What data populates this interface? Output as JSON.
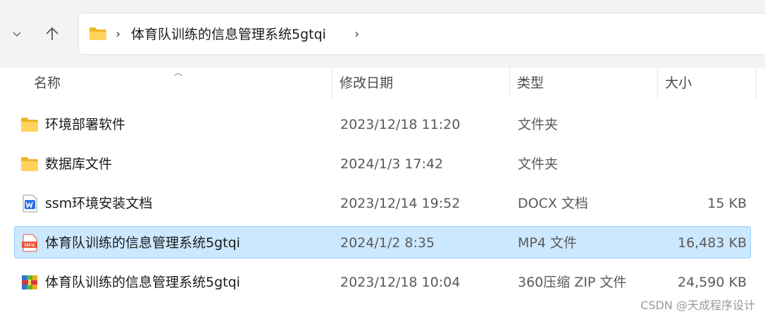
{
  "address": {
    "crumb": "体育队训练的信息管理系统5gtqi"
  },
  "columns": {
    "name": "名称",
    "date": "修改日期",
    "type": "类型",
    "size": "大小"
  },
  "files": [
    {
      "name": "环境部署软件",
      "date": "2023/12/18 11:20",
      "type": "文件夹",
      "size": "",
      "icon": "folder-icon",
      "selected": false
    },
    {
      "name": "数据库文件",
      "date": "2024/1/3 17:42",
      "type": "文件夹",
      "size": "",
      "icon": "folder-icon",
      "selected": false
    },
    {
      "name": "ssm环境安装文档",
      "date": "2023/12/14 19:52",
      "type": "DOCX 文档",
      "size": "15 KB",
      "icon": "docx-file-icon",
      "selected": false
    },
    {
      "name": "体育队训练的信息管理系统5gtqi",
      "date": "2024/1/2 8:35",
      "type": "MP4 文件",
      "size": "16,483 KB",
      "icon": "mp4-file-icon",
      "selected": true
    },
    {
      "name": "体育队训练的信息管理系统5gtqi",
      "date": "2023/12/18 10:04",
      "type": "360压缩 ZIP 文件",
      "size": "24,590 KB",
      "icon": "zip-archive-icon",
      "selected": false
    }
  ],
  "mp4_icon_label": "MP4",
  "watermark": "CSDN @天成程序设计",
  "colors": {
    "selection_bg": "#cce8ff",
    "selection_border": "#99d1ff",
    "folder": "#f8c94a",
    "docx": "#2b6fe0",
    "mp4": "#e8563a"
  }
}
